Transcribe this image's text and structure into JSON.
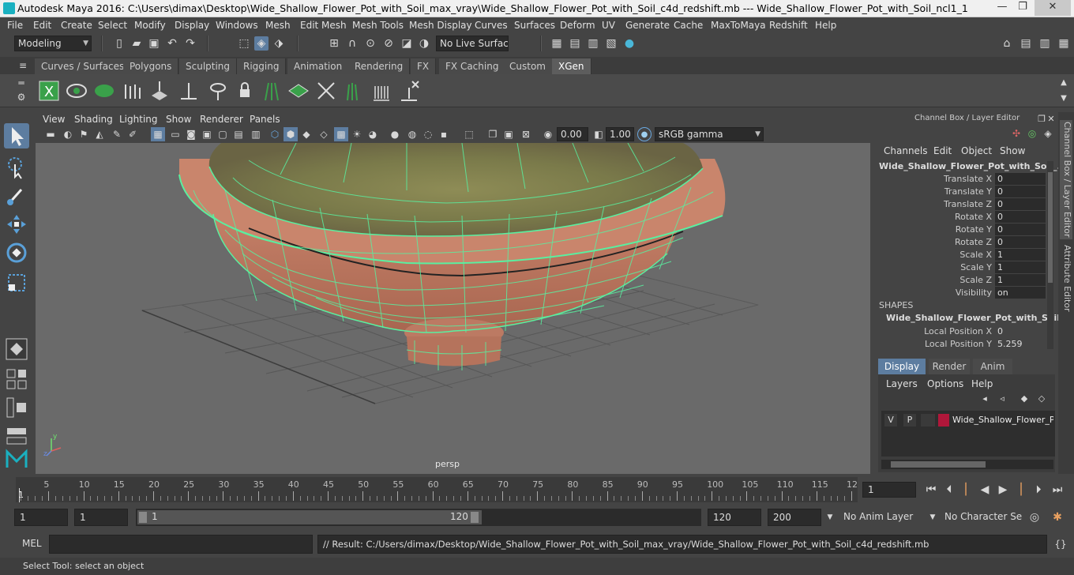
{
  "title_bar": {
    "title": "Autodesk Maya 2016: C:\\Users\\dimax\\Desktop\\Wide_Shallow_Flower_Pot_with_Soil_max_vray\\Wide_Shallow_Flower_Pot_with_Soil_c4d_redshift.mb   ---   Wide_Shallow_Flower_Pot_with_Soil_ncl1_1",
    "minimize": "—",
    "maximize": "❐",
    "close": "✕"
  },
  "menu": [
    "File",
    "Edit",
    "Create",
    "Select",
    "Modify",
    "Display",
    "Windows",
    "Mesh",
    "Edit Mesh",
    "Mesh Tools",
    "Mesh Display",
    "Curves",
    "Surfaces",
    "Deform",
    "UV",
    "Generate",
    "Cache",
    "MaxToMaya",
    "Redshift",
    "Help"
  ],
  "status_line": {
    "mode": "Modeling",
    "live_surface": "No Live Surface"
  },
  "shelf_tabs": [
    "Curves / Surfaces",
    "Polygons",
    "Sculpting",
    "Rigging",
    "Animation",
    "Rendering",
    "FX",
    "FX Caching",
    "Custom",
    "XGen"
  ],
  "active_shelf_tab": "XGen",
  "viewport": {
    "menu": [
      "View",
      "Shading",
      "Lighting",
      "Show",
      "Renderer",
      "Panels"
    ],
    "exposure": "0.00",
    "gamma": "1.00",
    "color_space": "sRGB gamma",
    "camera_label": "persp"
  },
  "channel_box": {
    "header": "Channel Box / Layer Editor",
    "menu": [
      "Channels",
      "Edit",
      "Object",
      "Show"
    ],
    "object_name": "Wide_Shallow_Flower_Pot_with_Soil_...",
    "channels": [
      {
        "label": "Translate X",
        "value": "0"
      },
      {
        "label": "Translate Y",
        "value": "0"
      },
      {
        "label": "Translate Z",
        "value": "0"
      },
      {
        "label": "Rotate X",
        "value": "0"
      },
      {
        "label": "Rotate Y",
        "value": "0"
      },
      {
        "label": "Rotate Z",
        "value": "0"
      },
      {
        "label": "Scale X",
        "value": "1"
      },
      {
        "label": "Scale Y",
        "value": "1"
      },
      {
        "label": "Scale Z",
        "value": "1"
      },
      {
        "label": "Visibility",
        "value": "on"
      }
    ],
    "shapes_header": "SHAPES",
    "shape_name": "Wide_Shallow_Flower_Pot_with_Soil...",
    "shape_channels": [
      {
        "label": "Local Position X",
        "value": "0"
      },
      {
        "label": "Local Position Y",
        "value": "5.259"
      }
    ]
  },
  "layer_editor": {
    "tabs": [
      "Display",
      "Render",
      "Anim"
    ],
    "active_tab": "Display",
    "menu": [
      "Layers",
      "Options",
      "Help"
    ],
    "layer": {
      "v": "V",
      "p": "P",
      "name": "Wide_Shallow_Flower_P",
      "color": "#b0173a"
    }
  },
  "side_tabs": [
    "Channel Box / Layer Editor",
    "Attribute Editor"
  ],
  "timeline": {
    "labels": [
      "5",
      "10",
      "15",
      "20",
      "25",
      "30",
      "35",
      "40",
      "45",
      "50",
      "55",
      "60",
      "65",
      "70",
      "75",
      "80",
      "85",
      "90",
      "95",
      "100",
      "105",
      "110",
      "115",
      "12"
    ],
    "current_marker": "1",
    "current_frame": "1"
  },
  "range": {
    "start": "1",
    "playback_start": "1",
    "slider_start": "1",
    "slider_end": "120",
    "playback_end": "120",
    "end": "200",
    "anim_layer": "No Anim Layer",
    "character_set": "No Character Set"
  },
  "command_line": {
    "label": "MEL",
    "result": "// Result: C:/Users/dimax/Desktop/Wide_Shallow_Flower_Pot_with_Soil_max_vray/Wide_Shallow_Flower_Pot_with_Soil_c4d_redshift.mb"
  },
  "help_line": "Select Tool: select an object",
  "colors": {
    "accent": "#5d7da0",
    "wireframe": "#59f0a0",
    "pot": "#c07b65",
    "soil": "#8a8a4a"
  }
}
